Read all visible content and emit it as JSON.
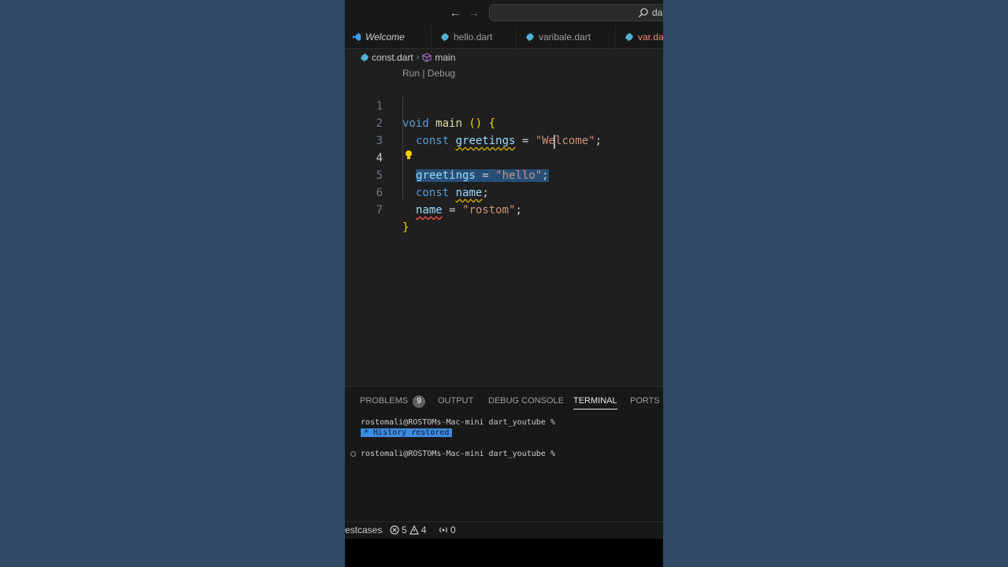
{
  "titlebar": {
    "back_icon": "arrow-left-icon",
    "forward_icon": "arrow-right-icon",
    "search_text": "dar"
  },
  "tabs": [
    {
      "label": "Welcome",
      "icon": "vscode-logo-icon"
    },
    {
      "label": "hello.dart",
      "icon": "dart-icon"
    },
    {
      "label": "varibale.dart",
      "icon": "dart-icon"
    },
    {
      "label": "var.da",
      "icon": "dart-icon"
    }
  ],
  "breadcrumb": {
    "file": "const.dart",
    "symbol": "main"
  },
  "editor": {
    "codelens": "Run | Debug",
    "line_numbers": [
      "1",
      "2",
      "3",
      "4",
      "5",
      "6",
      "7"
    ],
    "active_line": "4",
    "tokens": {
      "l1_kw": "void",
      "l1_fn": "main",
      "l1_paren": "()",
      "l1_brace": "{",
      "l2_kw": "const",
      "l2_var": "greetings",
      "l2_eq": " = ",
      "l2_str": "\"Welcome\"",
      "l2_semi": ";",
      "l4_var": "greetings",
      "l4_eq": " = ",
      "l4_str": "\"hello\"",
      "l4_semi": ";",
      "l5_kw": "const",
      "l5_var": "name",
      "l5_semi": ";",
      "l6_var": "name",
      "l6_eq": " = ",
      "l6_str": "\"rostom\"",
      "l6_semi": ";",
      "l7_brace": "}"
    }
  },
  "panel": {
    "tabs": {
      "problems": "PROBLEMS",
      "problems_count": "9",
      "output": "OUTPUT",
      "debug_console": "DEBUG CONSOLE",
      "terminal": "TERMINAL",
      "ports": "PORTS"
    },
    "active_tab": "TERMINAL",
    "terminal_lines": [
      "rostomali@ROSTOMs-Mac-mini dart_youtube %",
      "* History restored",
      "rostomali@ROSTOMs-Mac-mini dart_youtube %"
    ]
  },
  "statusbar": {
    "testcases": "estcases",
    "errors": "5",
    "warnings": "4",
    "ports": "0"
  },
  "colors": {
    "background": "#2f4863",
    "editor_bg": "#1f1f1f",
    "selection": "#264f78",
    "keyword": "#569cd6",
    "string": "#ce9178",
    "function": "#dcdcaa"
  }
}
